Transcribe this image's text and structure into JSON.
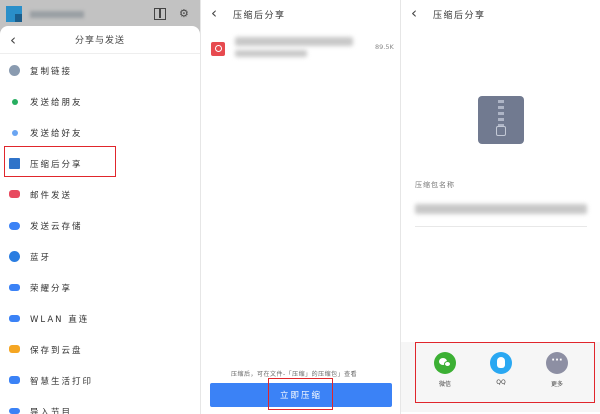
{
  "panel1": {
    "title": "分享与发送",
    "menu": [
      {
        "label": "复制链接",
        "icon": "link-icon",
        "color": "#8a9bb0"
      },
      {
        "label": "发送给朋友",
        "icon": "send-friend-icon",
        "color": "#27ae60"
      },
      {
        "label": "发送给好友",
        "icon": "send-contact-icon",
        "color": "#6aa5f2"
      },
      {
        "label": "压缩后分享",
        "icon": "compress-icon",
        "color": "#2f73c9"
      },
      {
        "label": "邮件发送",
        "icon": "mail-icon",
        "color": "#e84a5f"
      },
      {
        "label": "发送云存储",
        "icon": "cloud-icon",
        "color": "#3b82f6"
      },
      {
        "label": "蓝牙",
        "icon": "bluetooth-icon",
        "color": "#2a7de1"
      },
      {
        "label": "荣耀分享",
        "icon": "honor-share-icon",
        "color": "#3b82f6"
      },
      {
        "label": "WLAN 直连",
        "icon": "wlan-icon",
        "color": "#3b82f6"
      },
      {
        "label": "保存到云盘",
        "icon": "cloud-drive-icon",
        "color": "#f5a623"
      },
      {
        "label": "智慧生活打印",
        "icon": "print-icon",
        "color": "#3b82f6"
      },
      {
        "label": "导入节目",
        "icon": "import-icon",
        "color": "#3b82f6"
      }
    ]
  },
  "panel2": {
    "title": "压缩后分享",
    "file_size": "89.5K",
    "note": "压缩后，可在文件-「压缩」的压缩包」查看",
    "button_label": "立即压缩"
  },
  "panel3": {
    "title": "压缩后分享",
    "name_label": "压缩包名称",
    "share_options": [
      {
        "label": "微信",
        "icon": "wechat-icon",
        "color": "#3cb034"
      },
      {
        "label": "QQ",
        "icon": "qq-icon",
        "color": "#2aa8f2"
      },
      {
        "label": "更多",
        "icon": "more-icon",
        "color": "#8d8fa3"
      }
    ]
  },
  "colors": {
    "highlight": "#e0262c",
    "primary_button": "#3b82f6"
  }
}
